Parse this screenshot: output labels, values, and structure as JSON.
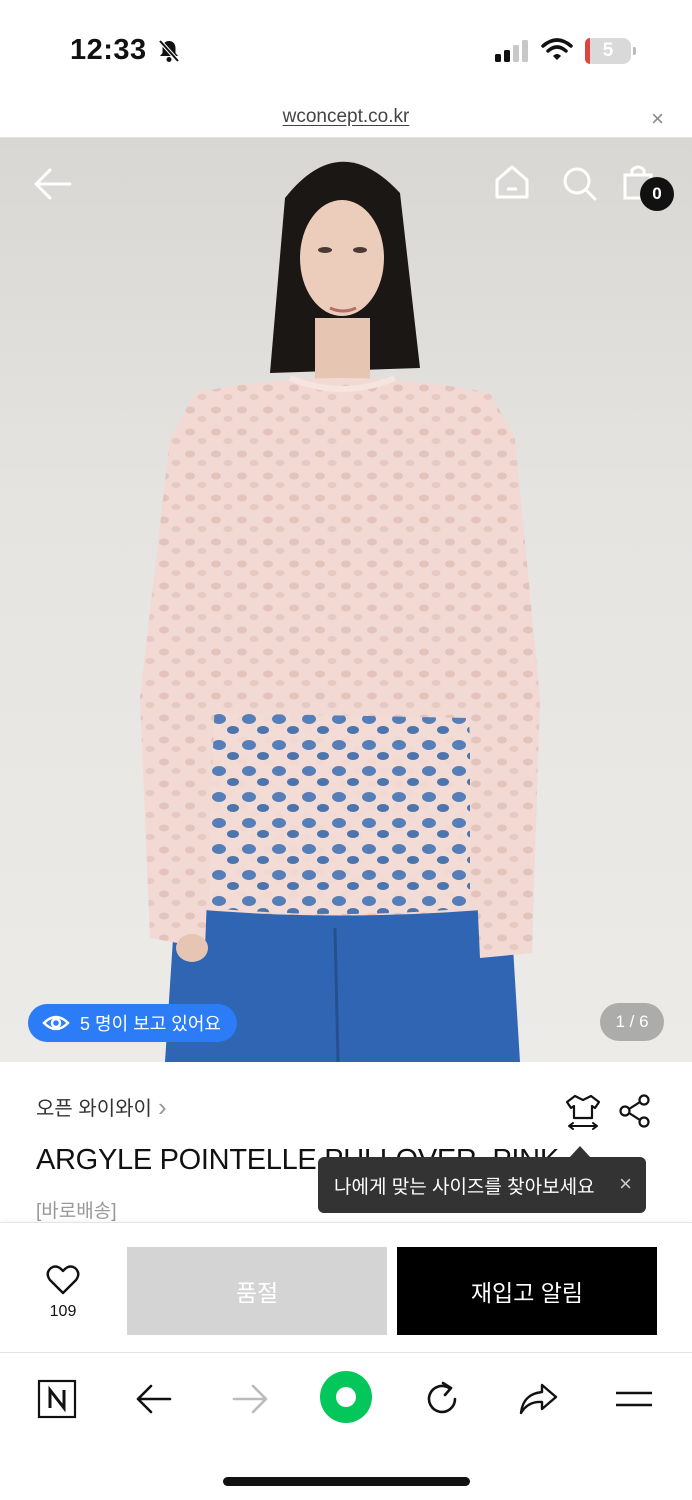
{
  "status_bar": {
    "time": "12:33",
    "battery_level": "5",
    "icons": [
      "bell-slash-icon",
      "cellular-signal-icon",
      "wifi-icon",
      "battery-icon"
    ]
  },
  "url_bar": {
    "url": "wconcept.co.kr",
    "close_label": "×"
  },
  "hero": {
    "viewers_text": "5 명이 보고 있어요",
    "page_indicator": "1 / 6",
    "cart_count": "0",
    "icons": [
      "back-arrow-icon",
      "home-icon",
      "search-icon",
      "shopping-bag-icon",
      "eye-icon"
    ]
  },
  "product": {
    "brand": "오픈 와이와이",
    "brand_chevron": "›",
    "title": "ARGYLE POINTELLE PULLOVER_PINK",
    "shipping_tag": "[바로배송]",
    "tooltip_text": "나에게 맞는 사이즈를 찾아보세요",
    "tooltip_close": "×"
  },
  "actions": {
    "like_count": "109",
    "soldout_label": "품절",
    "restock_label": "재입고 알림"
  },
  "browser_nav": {
    "icons": [
      "naver-n-icon",
      "back-icon",
      "forward-icon",
      "green-dot-icon",
      "reload-icon",
      "share-icon",
      "menu-icon"
    ]
  },
  "colors": {
    "accent_blue": "#2b7cf6",
    "restock_black": "#000000",
    "soldout_gray": "#d4d4d4",
    "naver_green": "#03c75a"
  }
}
